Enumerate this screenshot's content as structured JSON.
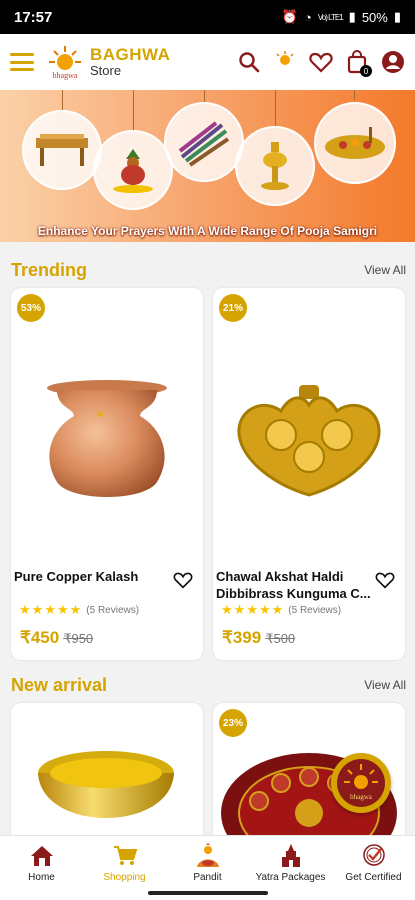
{
  "status_bar": {
    "time": "17:57",
    "network": "Vo) LTE1",
    "battery": "50%"
  },
  "header": {
    "brand_title": "BAGHWA",
    "brand_sub": "Store",
    "logo_text": "bhagwa",
    "cart_count": "0"
  },
  "banner": {
    "caption": "Enhance Your Prayers With A Wide Range Of Pooja Samigri"
  },
  "trending": {
    "title": "Trending",
    "view_all": "View All",
    "products": [
      {
        "name": "Pure Copper Kalash",
        "discount": "53%",
        "rating": 5,
        "reviews": "(5 Reviews)",
        "price": "₹450",
        "mrp": "₹950"
      },
      {
        "name": "Chawal Akshat Haldi Dibbibrass Kunguma C...",
        "discount": "21%",
        "rating": 5,
        "reviews": "(5 Reviews)",
        "price": "₹399",
        "mrp": "₹500"
      }
    ]
  },
  "new_arrival": {
    "title": "New arrival",
    "view_all": "View All",
    "products": [
      {
        "discount": ""
      },
      {
        "discount": "23%"
      }
    ]
  },
  "bottom_nav": [
    {
      "label": "Home",
      "icon": "home-icon",
      "active": false
    },
    {
      "label": "Shopping",
      "icon": "shopping-cart-icon",
      "active": true
    },
    {
      "label": "Pandit",
      "icon": "pandit-icon",
      "active": false
    },
    {
      "label": "Yatra Packages",
      "icon": "temple-icon",
      "active": false
    },
    {
      "label": "Get Certified",
      "icon": "certificate-icon",
      "active": false
    }
  ],
  "colors": {
    "accent": "#d6a400",
    "maroon": "#8b1a1a"
  }
}
